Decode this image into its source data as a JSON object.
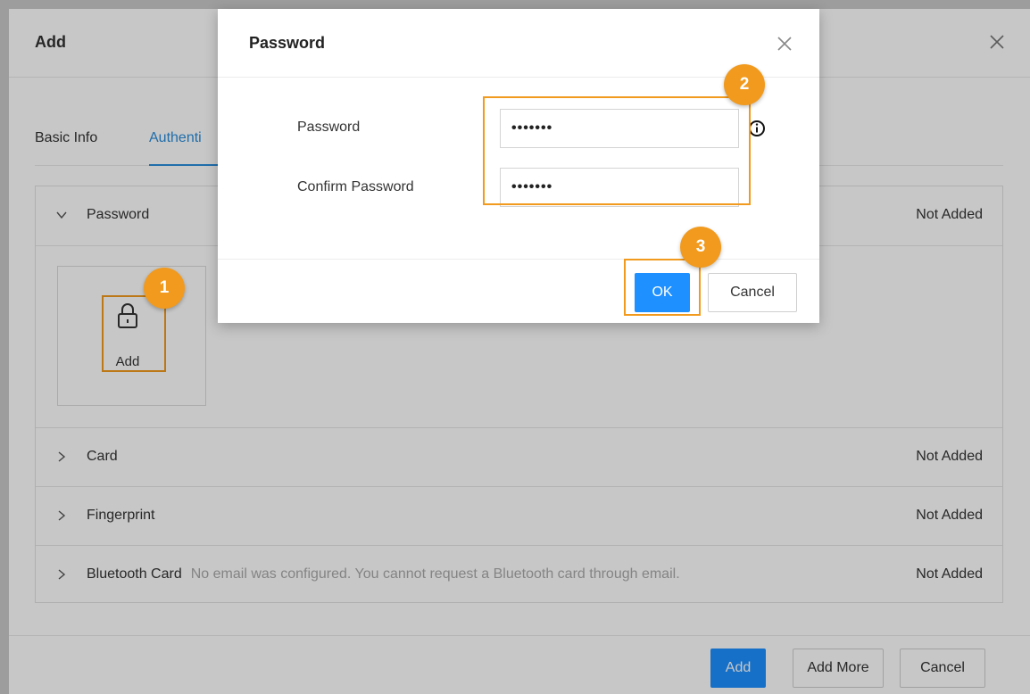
{
  "base_dialog": {
    "title": "Add",
    "tabs": [
      {
        "label": "Basic Info"
      },
      {
        "label": "Authenti"
      }
    ],
    "sections": [
      {
        "label": "Password",
        "status": "Not Added",
        "expanded": true
      },
      {
        "label": "Card",
        "status": "Not Added"
      },
      {
        "label": "Fingerprint",
        "status": "Not Added"
      },
      {
        "label": "Bluetooth Card",
        "note": "No email was configured. You cannot request a Bluetooth card through email.",
        "status": "Not Added"
      }
    ],
    "password_tile": {
      "label": "Add",
      "icon": "lock-icon"
    },
    "footer": {
      "add": "Add",
      "add_more": "Add More",
      "cancel": "Cancel"
    }
  },
  "modal": {
    "title": "Password",
    "password_label": "Password",
    "password_value": "•••••••",
    "confirm_label": "Confirm Password",
    "confirm_value": "•••••••",
    "ok": "OK",
    "cancel": "Cancel"
  },
  "badges": {
    "one": "1",
    "two": "2",
    "three": "3"
  },
  "colors": {
    "accent": "#1e90ff",
    "highlight": "#f19a1d",
    "tab_active": "#2a8ddb"
  }
}
